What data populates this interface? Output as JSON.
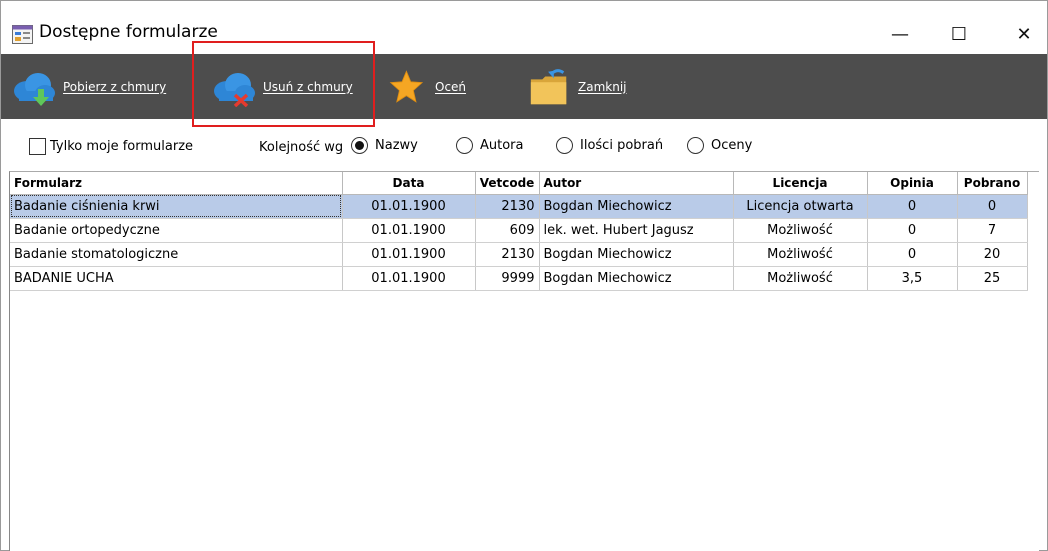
{
  "window": {
    "title": "Dostępne formularze",
    "controls": {
      "minimize": "—",
      "maximize": "☐",
      "close": "✕"
    }
  },
  "toolbar": {
    "download": {
      "label": "Pobierz z chmury",
      "icon": "cloud-download-icon"
    },
    "remove": {
      "label": "Usuń z chmury",
      "icon": "cloud-remove-icon"
    },
    "rate": {
      "label": "Oceń",
      "icon": "star-icon"
    },
    "close": {
      "label": "Zamknij",
      "icon": "folder-close-icon"
    },
    "accent_color": "#4d4d4d",
    "highlight_color": "#e01e1e"
  },
  "filters": {
    "only_mine": {
      "label": "Tylko moje formularze",
      "checked": false
    },
    "sort_label": "Kolejność wg",
    "sort_options": [
      {
        "label": "Nazwy",
        "checked": true
      },
      {
        "label": "Autora",
        "checked": false
      },
      {
        "label": "Ilości pobrań",
        "checked": false
      },
      {
        "label": "Oceny",
        "checked": false
      }
    ]
  },
  "table": {
    "columns": [
      "Formularz",
      "Data",
      "Vetcode",
      "Autor",
      "Licencja",
      "Opinia",
      "Pobrano"
    ],
    "rows": [
      [
        "Badanie ciśnienia krwi",
        "01.01.1900",
        "2130",
        "Bogdan Miechowicz",
        "Licencja otwarta",
        "0",
        "0"
      ],
      [
        "Badanie ortopedyczne",
        "01.01.1900",
        "609",
        "lek. wet. Hubert Jagusz",
        "Możliwość",
        "0",
        "7"
      ],
      [
        "Badanie stomatologiczne",
        "01.01.1900",
        "2130",
        "Bogdan Miechowicz",
        "Możliwość",
        "0",
        "20"
      ],
      [
        "BADANIE UCHA",
        "01.01.1900",
        "9999",
        "Bogdan Miechowicz",
        "Możliwość",
        "3,5",
        "25"
      ]
    ],
    "selected_row": 0,
    "selection_color": "#b9cbe8"
  }
}
